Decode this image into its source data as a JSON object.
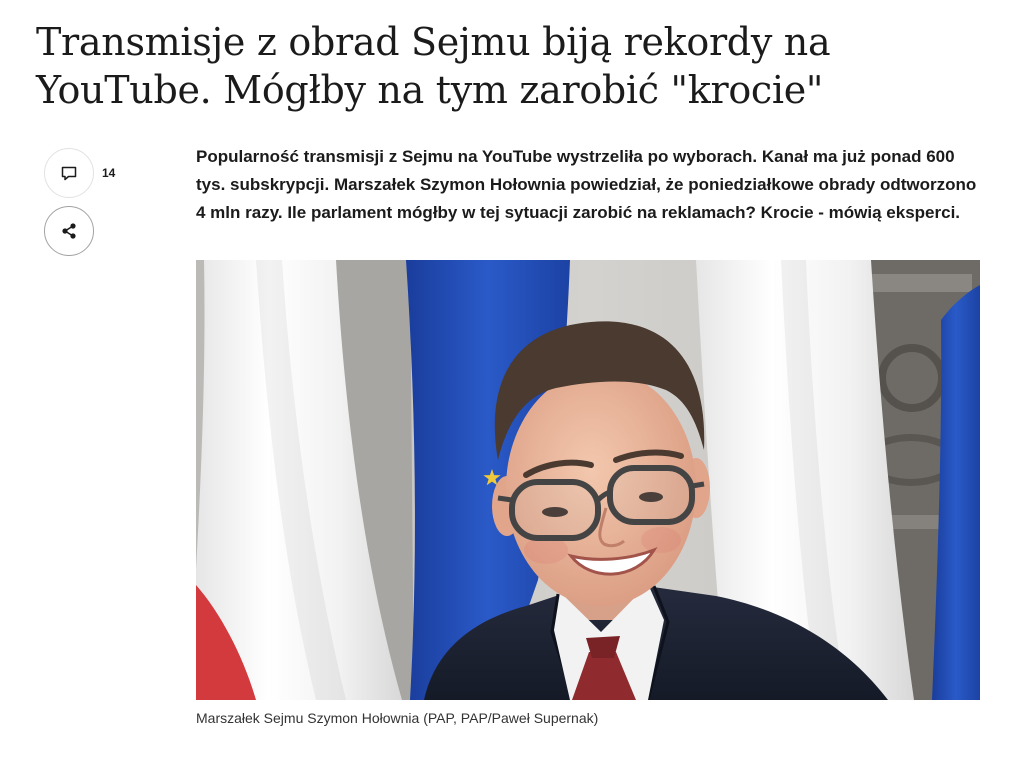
{
  "article": {
    "title": "Transmisje z obrad Sejmu biją rekordy na YouTube. Mógłby na tym zarobić \"krocie\"",
    "lead": "Popularność transmisji z Sejmu na YouTube wystrzeliła po wyborach. Kanał ma już ponad 600 tys. subskrypcji. Marszałek Szymon Hołownia powiedział, że poniedziałkowe obrady odtworzono 4 mln razy. Ile parlament mógłby w tej sytuacji zarobić na reklamach? Krocie - mówią eksperci.",
    "photo": {
      "caption": "Marszałek Sejmu Szymon Hołownia (PAP, PAP/Paweł Supernak)"
    }
  },
  "actions": {
    "comments": {
      "icon": "comment-icon",
      "count": "14"
    },
    "share": {
      "icon": "share-icon"
    }
  },
  "colors": {
    "text": "#1b1b1b",
    "caption": "#333333",
    "button_border": "#e2e2e2",
    "share_button_border": "#a3a3a3"
  }
}
